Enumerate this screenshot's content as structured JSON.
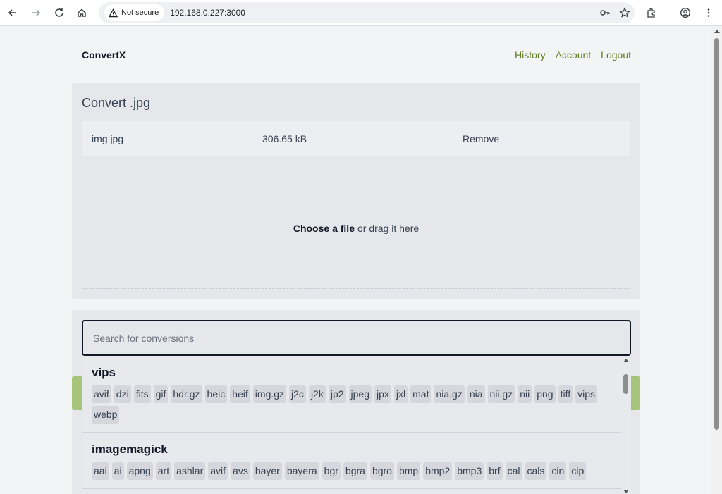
{
  "browser": {
    "security_label": "Not secure",
    "url": "192.168.0.227:3000",
    "icons": [
      "back-icon",
      "forward-icon",
      "reload-icon",
      "home-icon",
      "warning-icon",
      "key-icon",
      "star-icon",
      "extensions-icon",
      "profile-icon",
      "menu-icon"
    ]
  },
  "header": {
    "brand": "ConvertX",
    "nav": {
      "history": "History",
      "account": "Account",
      "logout": "Logout"
    },
    "accent_color": "#5f7d22"
  },
  "convert": {
    "title": "Convert .jpg",
    "file": {
      "name": "img.jpg",
      "size": "306.65 kB",
      "remove_label": "Remove"
    },
    "dropzone": {
      "choose_label": "Choose a file",
      "rest_label": "or drag it here"
    }
  },
  "search": {
    "placeholder": "Search for conversions"
  },
  "converters": [
    {
      "name": "vips",
      "formats": [
        "avif",
        "dzi",
        "fits",
        "gif",
        "hdr.gz",
        "heic",
        "heif",
        "img.gz",
        "j2c",
        "j2k",
        "jp2",
        "jpeg",
        "jpx",
        "jxl",
        "mat",
        "nia.gz",
        "nia",
        "nii.gz",
        "nii",
        "png",
        "tiff",
        "vips",
        "webp"
      ]
    },
    {
      "name": "imagemagick",
      "formats": [
        "aai",
        "ai",
        "apng",
        "art",
        "ashlar",
        "avif",
        "avs",
        "bayer",
        "bayera",
        "bgr",
        "bgra",
        "bgro",
        "bmp",
        "bmp2",
        "bmp3",
        "brf",
        "cal",
        "cals",
        "cin",
        "cip"
      ]
    }
  ]
}
